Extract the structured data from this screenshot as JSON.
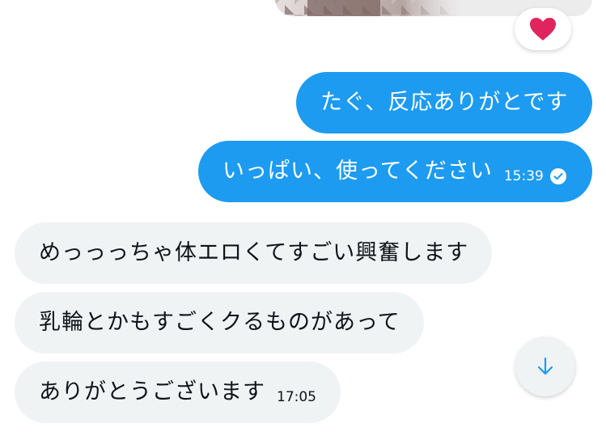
{
  "conversation": {
    "reaction": {
      "icon": "heart-icon",
      "color": "#e0245e"
    },
    "messages": [
      {
        "direction": "outgoing",
        "text": "たぐ、反応ありがとです",
        "time": ""
      },
      {
        "direction": "outgoing",
        "text": "いっぱい、使ってください",
        "time": "15:39",
        "status": "read-check-icon"
      },
      {
        "direction": "incoming",
        "text": "めっっっちゃ体エロくてすごい興奮します",
        "time": ""
      },
      {
        "direction": "incoming",
        "text": "乳輪とかもすごくクるものがあって",
        "time": ""
      },
      {
        "direction": "incoming",
        "text": "ありがとうございます",
        "time": "17:05"
      }
    ]
  },
  "scroll_button": {
    "icon": "arrow-down-icon"
  },
  "colors": {
    "outgoing_bubble": "#1d9bf0",
    "incoming_bubble": "#eff3f4",
    "heart": "#e0245e"
  }
}
